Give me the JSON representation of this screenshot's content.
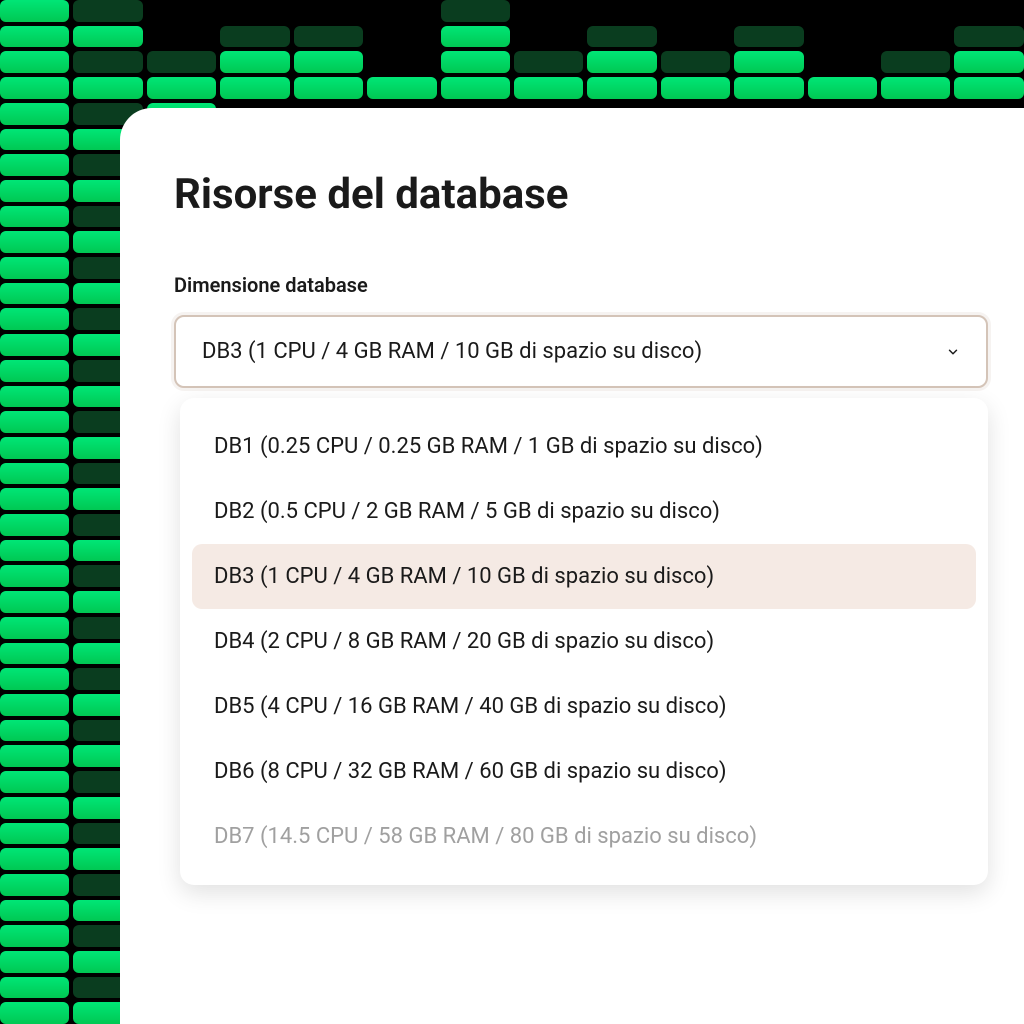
{
  "panel": {
    "title": "Risorse del database",
    "fieldLabel": "Dimensione database",
    "selectedValue": "DB3 (1 CPU / 4 GB RAM / 10 GB di spazio su disco)"
  },
  "options": [
    {
      "label": "DB1 (0.25 CPU / 0.25 GB RAM / 1 GB di spazio su disco)",
      "selected": false,
      "faded": false
    },
    {
      "label": "DB2 (0.5 CPU / 2 GB RAM / 5 GB di spazio su disco)",
      "selected": false,
      "faded": false
    },
    {
      "label": "DB3 (1 CPU / 4 GB RAM / 10 GB di spazio su disco)",
      "selected": true,
      "faded": false
    },
    {
      "label": "DB4 (2 CPU / 8 GB RAM / 20 GB di spazio su disco)",
      "selected": false,
      "faded": false
    },
    {
      "label": "DB5 (4 CPU / 16 GB RAM / 40 GB di spazio su disco)",
      "selected": false,
      "faded": false
    },
    {
      "label": "DB6 (8 CPU / 32 GB RAM / 60 GB di spazio su disco)",
      "selected": false,
      "faded": false
    },
    {
      "label": "DB7 (14.5 CPU / 58 GB RAM / 80 GB di spazio su disco)",
      "selected": false,
      "faded": true
    }
  ]
}
